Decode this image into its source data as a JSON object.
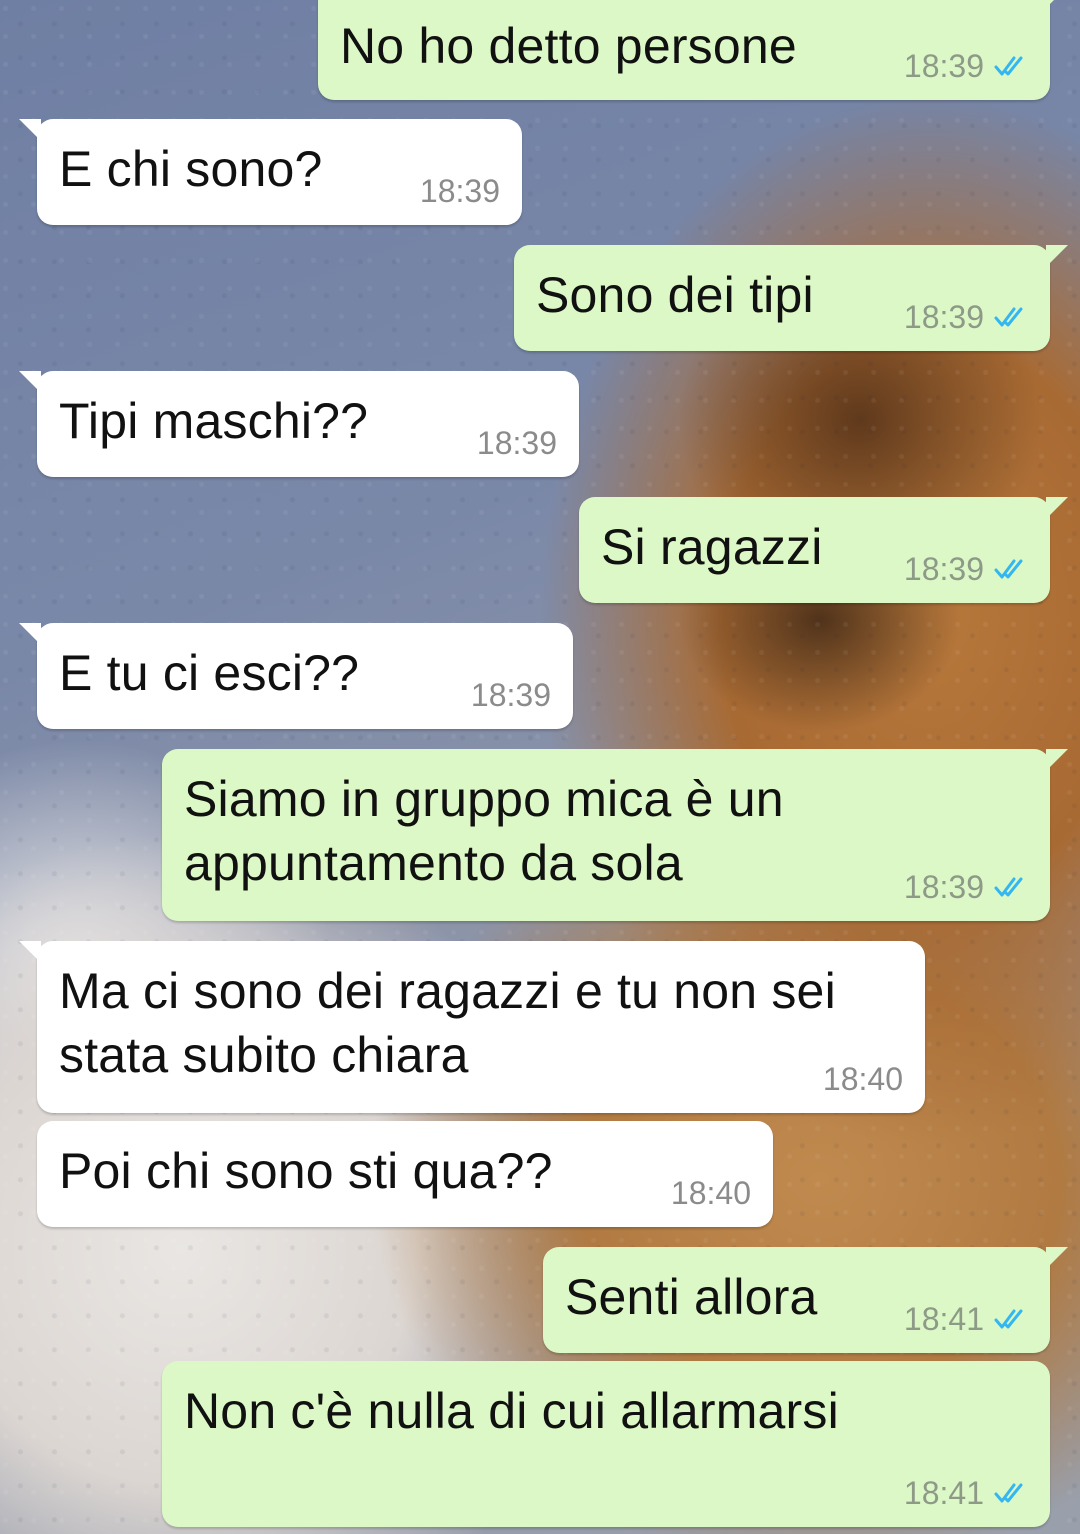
{
  "colors": {
    "incoming_bubble": "#ffffff",
    "outgoing_bubble": "#dcf8c6",
    "timestamp": "#8b8b8b",
    "read_ticks": "#34b7f1"
  },
  "messages": [
    {
      "direction": "out",
      "text": "No ho detto persone",
      "time": "18:39",
      "status_icon": "double-check-read-icon"
    },
    {
      "direction": "in",
      "text": "E chi sono?",
      "time": "18:39"
    },
    {
      "direction": "out",
      "text": "Sono dei tipi",
      "time": "18:39",
      "status_icon": "double-check-read-icon"
    },
    {
      "direction": "in",
      "text": "Tipi maschi??",
      "time": "18:39"
    },
    {
      "direction": "out",
      "text": "Si ragazzi",
      "time": "18:39",
      "status_icon": "double-check-read-icon"
    },
    {
      "direction": "in",
      "text": "E tu ci esci??",
      "time": "18:39"
    },
    {
      "direction": "out",
      "text": "Siamo in gruppo mica è un\nappuntamento da sola",
      "time": "18:39",
      "status_icon": "double-check-read-icon"
    },
    {
      "direction": "in",
      "text": "Ma ci sono dei ragazzi e tu non sei\nstata subito chiara",
      "time": "18:40"
    },
    {
      "direction": "in",
      "text": "Poi chi sono sti qua??",
      "time": "18:40"
    },
    {
      "direction": "out",
      "text": "Senti allora",
      "time": "18:41",
      "status_icon": "double-check-read-icon"
    },
    {
      "direction": "out",
      "text": "Non c'è nulla di cui allarmarsi",
      "time": "18:41",
      "status_icon": "double-check-read-icon"
    }
  ]
}
